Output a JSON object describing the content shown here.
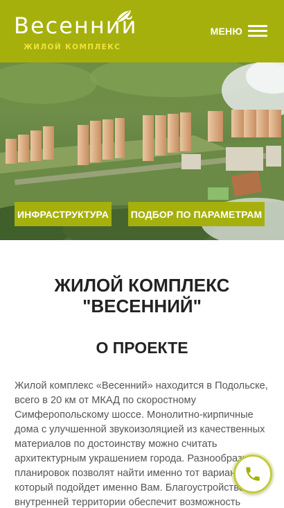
{
  "header": {
    "logo_title": "Весенний",
    "logo_subtitle": "ЖИЛОЙ КОМПЛЕКС",
    "menu_label": "МЕНЮ",
    "menu_icon": "hamburger-icon",
    "logo_icon": "leaf-icon"
  },
  "hero": {
    "buttons": [
      {
        "label": "ИНФРАСТРУКТУРА"
      },
      {
        "label": "ПОДБОР ПО ПАРАМЕТРАМ"
      }
    ]
  },
  "main": {
    "title": "ЖИЛОЙ КОМПЛЕКС\n\"ВЕСЕННИЙ\"",
    "section_title": "О ПРОЕКТЕ",
    "about_text": "Жилой комплекс «Весенний» находится в Подольске, всего в 20 км от МКАД по скоростному Симферопольскому шоссе. Монолитно-кирпичные дома с улучшенной звукоизоляцией из качественных материалов по достоинству можно считать архитектурным украшением города. Разнообразие планировок позволят найти именно тот вариант, который подойдет именно Вам. Благоустройство внутренней территории обеспечит возможность отдыха"
  },
  "call_button": {
    "icon": "phone-icon"
  },
  "colors": {
    "brand_green": "#a6b00d",
    "logo_accent": "#f0e23a",
    "call_ring": "#c3cb3a",
    "text_dark": "#222222",
    "text_body": "#555555"
  }
}
